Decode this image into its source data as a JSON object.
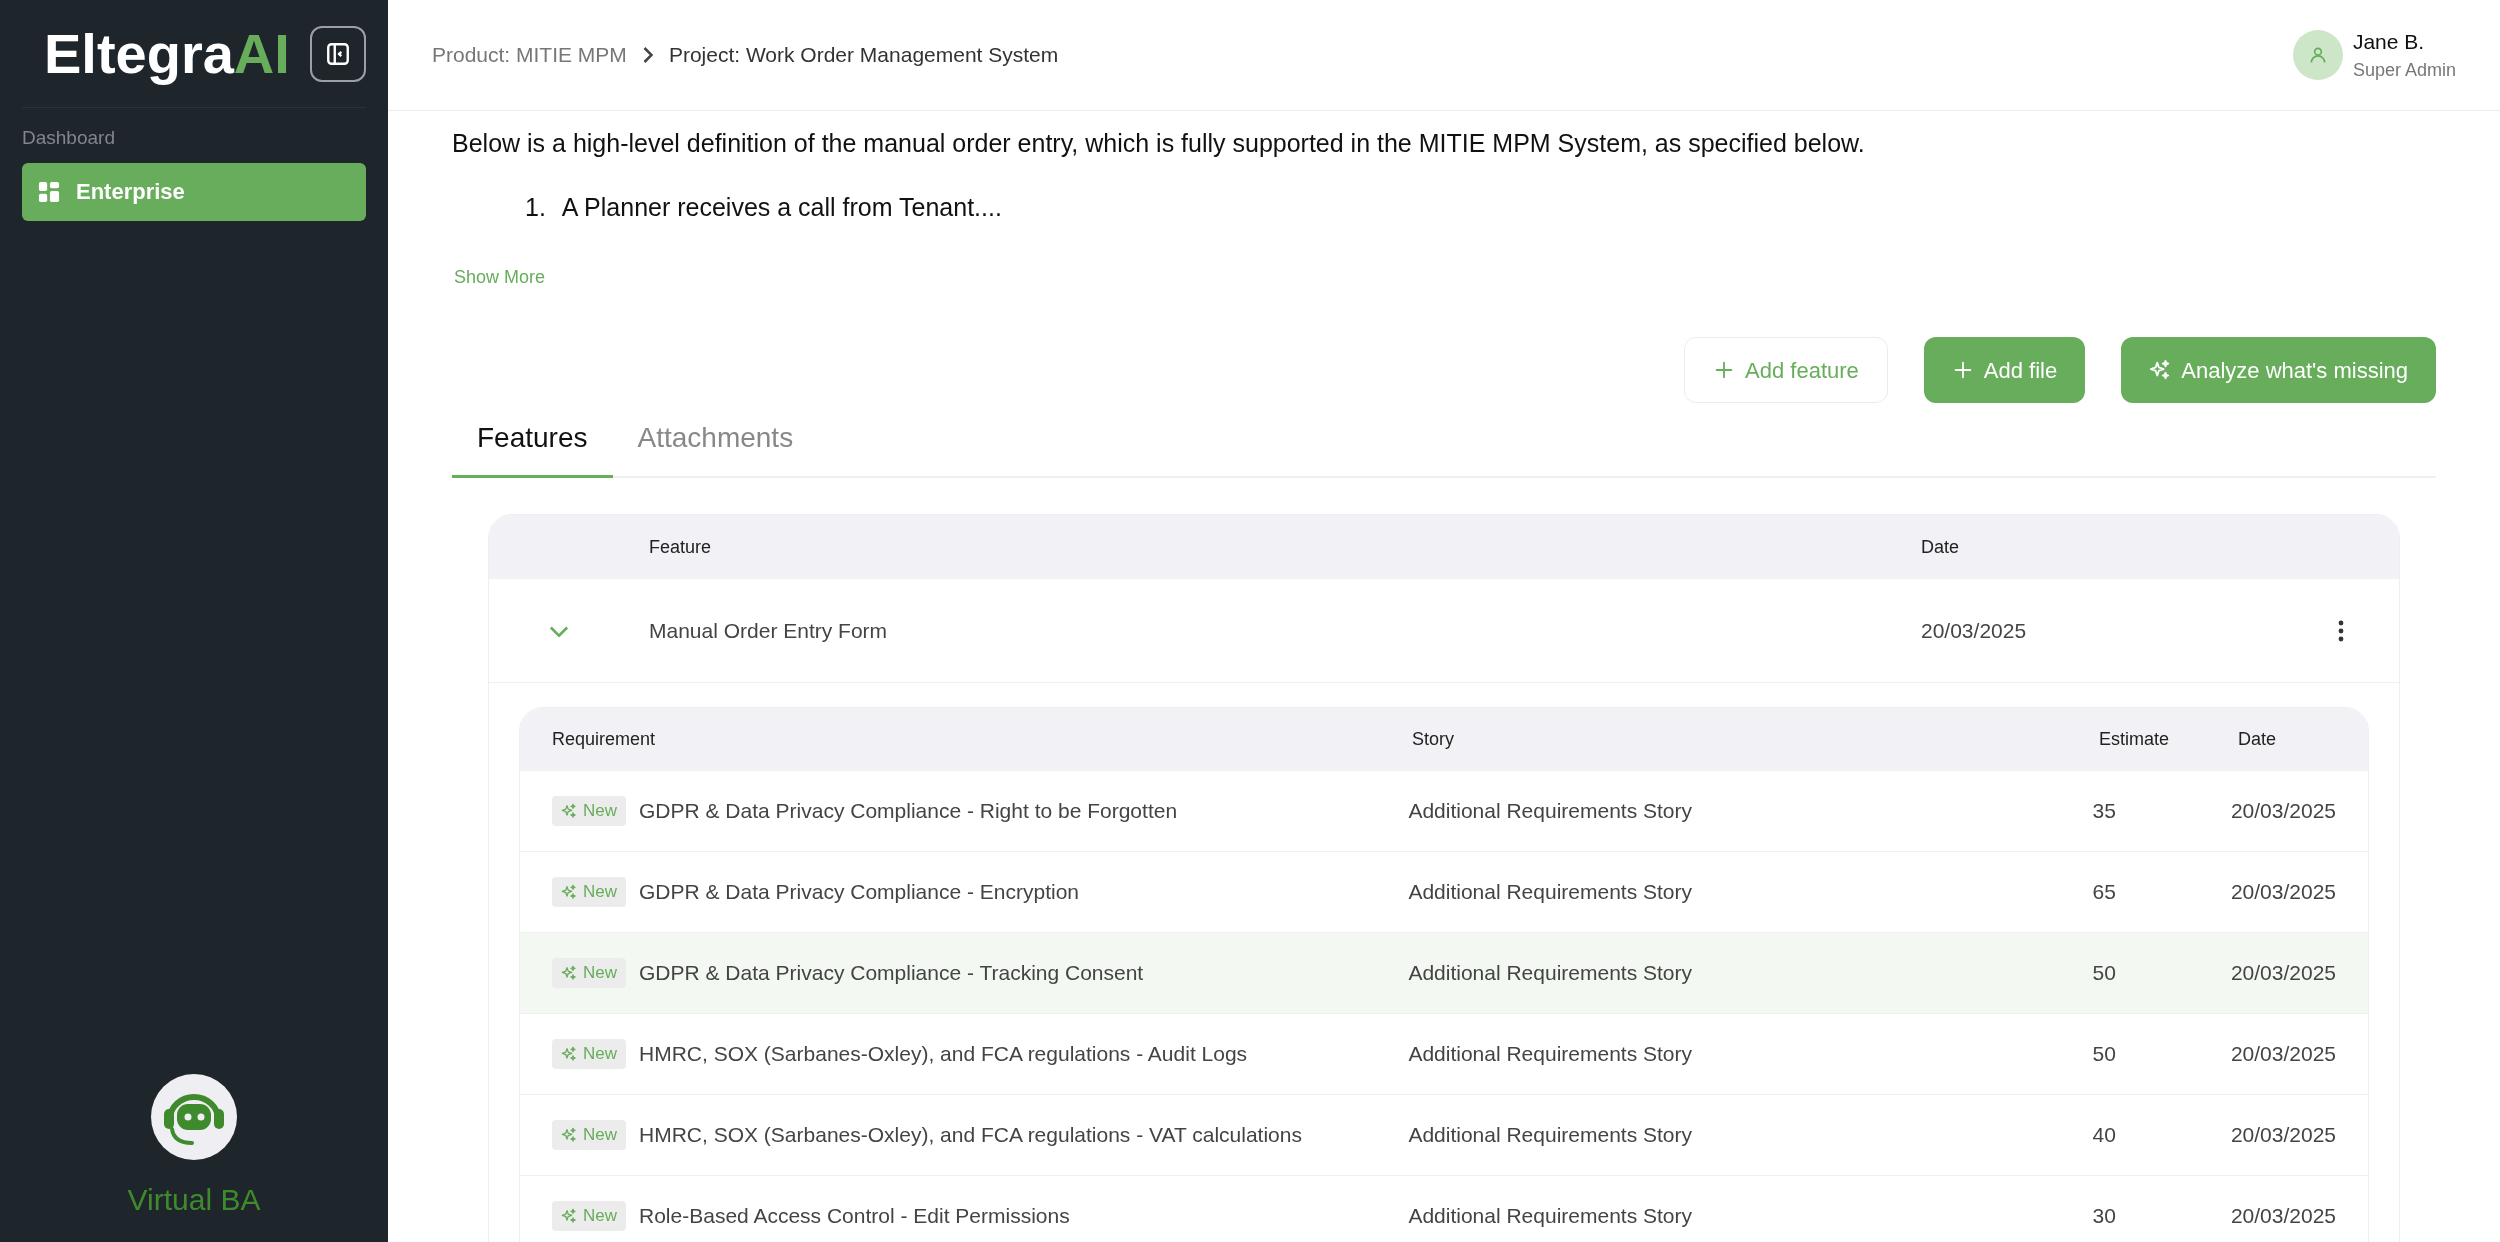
{
  "sidebar": {
    "logo": {
      "main": "Eltegra",
      "accent": "AI"
    },
    "section_label": "Dashboard",
    "items": [
      {
        "label": "Enterprise",
        "selected": true
      }
    ],
    "assistant": {
      "label": "Virtual BA"
    }
  },
  "header": {
    "breadcrumbs": [
      "Product: MITIE MPM",
      "Project: Work Order Management System"
    ],
    "user": {
      "name": "Jane B.",
      "role": "Super Admin"
    }
  },
  "description": {
    "text": "Below is a high-level definition of the manual order entry, which is fully supported in the MITIE MPM System, as specified below.",
    "list": [
      {
        "number": "1.",
        "text": "A Planner receives a call from Tenant...."
      }
    ],
    "show_more": "Show More"
  },
  "actions": [
    {
      "label": "Add feature",
      "kind": "outline"
    },
    {
      "label": "Add file",
      "kind": "solid"
    },
    {
      "label": "Analyze what's missing",
      "kind": "ai"
    }
  ],
  "tabs": [
    {
      "label": "Features",
      "selected": true
    },
    {
      "label": "Attachments",
      "selected": false
    }
  ],
  "features_table": {
    "columns": [
      "Feature",
      "Date"
    ],
    "rows": [
      {
        "name": "Manual Order Entry Form",
        "date": "20/03/2025",
        "expanded": true,
        "requirements": {
          "columns": [
            "Requirement",
            "Story",
            "Estimate",
            "Date"
          ],
          "rows": [
            {
              "badge": "New",
              "requirement": "GDPR & Data Privacy Compliance - Right to be Forgotten",
              "story": "Additional Requirements Story",
              "estimate": "35",
              "date": "20/03/2025",
              "selected": false
            },
            {
              "badge": "New",
              "requirement": "GDPR & Data Privacy Compliance - Encryption",
              "story": "Additional Requirements Story",
              "estimate": "65",
              "date": "20/03/2025",
              "selected": false
            },
            {
              "badge": "New",
              "requirement": "GDPR & Data Privacy Compliance - Tracking Consent",
              "story": "Additional Requirements Story",
              "estimate": "50",
              "date": "20/03/2025",
              "selected": true
            },
            {
              "badge": "New",
              "requirement": "HMRC, SOX (Sarbanes-Oxley), and FCA regulations - Audit Logs",
              "story": "Additional Requirements Story",
              "estimate": "50",
              "date": "20/03/2025",
              "selected": false
            },
            {
              "badge": "New",
              "requirement": "HMRC, SOX (Sarbanes-Oxley), and FCA regulations - VAT calculations",
              "story": "Additional Requirements Story",
              "estimate": "40",
              "date": "20/03/2025",
              "selected": false
            },
            {
              "badge": "New",
              "requirement": "Role-Based Access Control - Edit Permissions",
              "story": "Additional Requirements Story",
              "estimate": "30",
              "date": "20/03/2025",
              "selected": false
            }
          ]
        }
      }
    ]
  }
}
